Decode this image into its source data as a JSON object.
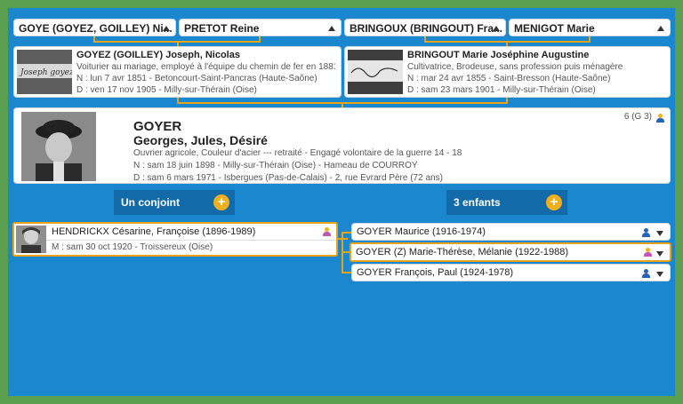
{
  "parents": {
    "father_father": "GOYE (GOYEZ, GOILLEY) Ni...",
    "father_mother": "PRETOT Reine",
    "mother_father": "BRINGOUX (BRINGOUT) Fra...",
    "mother_mother": "MENIGOT Marie"
  },
  "father": {
    "name": "GOYEZ (GOILLEY) Joseph, Nicolas",
    "occupation": "Voiturier au mariage, employé à l'équipe du chemin de fer en 1881,...",
    "birth": "N : lun 7 avr 1851 - Betoncourt-Saint-Pancras (Haute-Saône)",
    "death": "D : ven 17 nov 1905 - Milly-sur-Thérain (Oise)",
    "signature": "Joseph goyez"
  },
  "mother": {
    "name": "BRINGOUT Marie Joséphine Augustine",
    "occupation": "Cultivatrice, Brodeuse, sans profession puis ménagère",
    "birth": "N : mar 24 avr 1855 - Saint-Bresson (Haute-Saône)",
    "death": "D : sam 23 mars 1901 - Milly-sur-Thérain (Oise)"
  },
  "main": {
    "surname": "GOYER",
    "given": "Georges, Jules, Désiré",
    "occupation": "Ouvrier agricole, Couleur d'acier --- retraité - Engagé volontaire de la guerre 14 - 18",
    "birth": "N : sam 18 juin 1898 - Milly-sur-Thérain (Oise) - Hameau de COURROY",
    "death": "D : sam 6 mars 1971 - Isbergues (Pas-de-Calais) - 2, rue Evrard Père (72 ans)",
    "gen": "6 (G 3)"
  },
  "spouse_bar": {
    "label": "Un conjoint",
    "plus": "+"
  },
  "children_bar": {
    "label": "3 enfants",
    "plus": "+"
  },
  "spouse": {
    "name": "HENDRICKX Césarine, Françoise (1896-1989)",
    "marriage": "M : sam 30 oct 1920 - Troissereux (Oise)"
  },
  "children": [
    {
      "name": "GOYER Maurice (1916-1974)"
    },
    {
      "name": "GOYER (Z) Marie-Thérèse, Mélanie (1922-1988)"
    },
    {
      "name": "GOYER François, Paul (1924-1978)"
    }
  ],
  "colors": {
    "accent": "#f0b01e",
    "male": "#2462b5",
    "female": "#c054b8"
  }
}
